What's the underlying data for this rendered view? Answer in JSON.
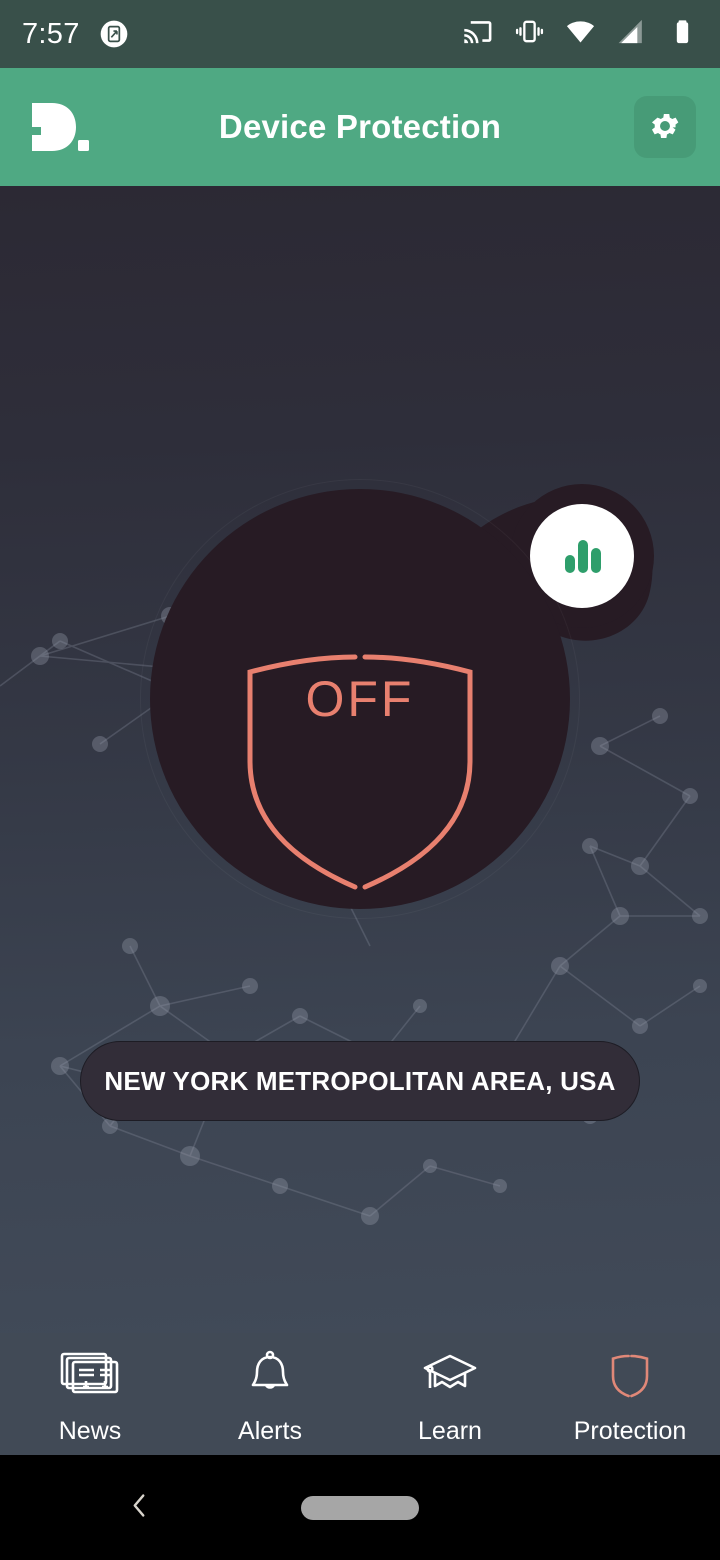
{
  "status_bar": {
    "time": "7:57",
    "icons": [
      "screenshot-icon",
      "cast-icon",
      "vibrate-icon",
      "wifi-icon",
      "cellular-signal-icon",
      "battery-icon"
    ],
    "background_color": "#39504a"
  },
  "app_bar": {
    "logo_text": "D.",
    "title": "Device Protection",
    "settings_icon": "gear-icon",
    "background_color": "#4fa983"
  },
  "main": {
    "protection_state": "OFF",
    "shield_color": "#e8806f",
    "circle_color": "#271b24",
    "stats_icon": "bar-chart-icon",
    "stats_icon_color": "#2e9e6b",
    "location": "NEW YORK METROPOLITAN AREA, USA"
  },
  "bottom_nav": {
    "items": [
      {
        "label": "News",
        "icon": "news-cards-icon",
        "active": false
      },
      {
        "label": "Alerts",
        "icon": "bell-icon",
        "active": false
      },
      {
        "label": "Learn",
        "icon": "graduation-cap-icon",
        "active": false
      },
      {
        "label": "Protection",
        "icon": "shield-icon",
        "active": true
      }
    ],
    "active_color": "#e08878",
    "inactive_color": "#ffffff",
    "background_color": "#414a56"
  },
  "android_nav": {
    "back_icon": "back-chevron-icon",
    "home_icon": "home-pill-icon"
  }
}
